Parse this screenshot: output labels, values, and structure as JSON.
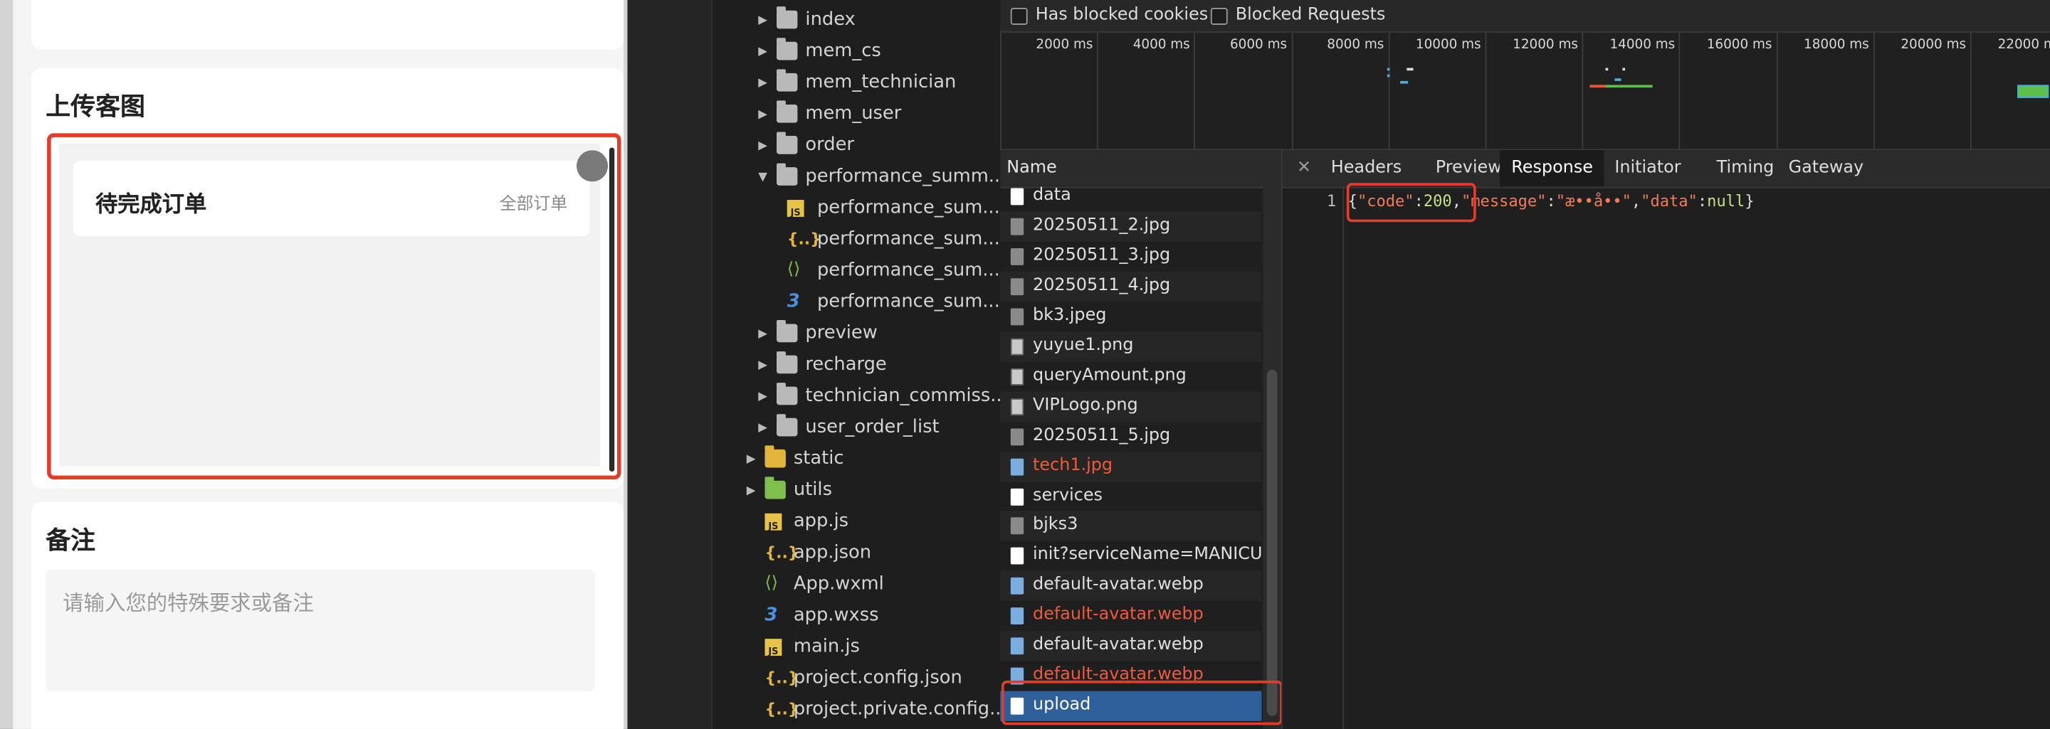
{
  "phone": {
    "upload_title": "上传客图",
    "pending_orders_title": "待完成订单",
    "all_orders_link": "全部订单",
    "remark_title": "备注",
    "remark_placeholder": "请输入您的特殊要求或备注"
  },
  "file_tree": {
    "items": [
      {
        "label": "index",
        "type": "folder",
        "expanded": false
      },
      {
        "label": "mem_cs",
        "type": "folder",
        "expanded": false
      },
      {
        "label": "mem_technician",
        "type": "folder",
        "expanded": false
      },
      {
        "label": "mem_user",
        "type": "folder",
        "expanded": false
      },
      {
        "label": "order",
        "type": "folder",
        "expanded": false
      },
      {
        "label": "performance_summ...",
        "type": "folder",
        "expanded": true
      },
      {
        "label": "performance_sum...",
        "type": "js"
      },
      {
        "label": "performance_sum...",
        "type": "json"
      },
      {
        "label": "performance_sum...",
        "type": "wxml"
      },
      {
        "label": "performance_sum...",
        "type": "wxss"
      },
      {
        "label": "preview",
        "type": "folder",
        "expanded": false
      },
      {
        "label": "recharge",
        "type": "folder",
        "expanded": false
      },
      {
        "label": "technician_commiss...",
        "type": "folder",
        "expanded": false
      },
      {
        "label": "user_order_list",
        "type": "folder",
        "expanded": false
      },
      {
        "label": "static",
        "type": "folder-yellow",
        "expanded": false
      },
      {
        "label": "utils",
        "type": "folder-green",
        "expanded": false
      },
      {
        "label": "app.js",
        "type": "js"
      },
      {
        "label": "app.json",
        "type": "json"
      },
      {
        "label": "App.wxml",
        "type": "wxml"
      },
      {
        "label": "app.wxss",
        "type": "wxss"
      },
      {
        "label": "main.js",
        "type": "js"
      },
      {
        "label": "project.config.json",
        "type": "json"
      },
      {
        "label": "project.private.config...",
        "type": "json"
      }
    ]
  },
  "devtools": {
    "filters": {
      "blocked_cookies": "Has blocked cookies",
      "blocked_requests": "Blocked Requests"
    },
    "timeline_ticks": [
      "2000 ms",
      "4000 ms",
      "6000 ms",
      "8000 ms",
      "10000 ms",
      "12000 ms",
      "14000 ms",
      "16000 ms",
      "18000 ms",
      "20000 ms",
      "22000 ms"
    ],
    "name_header": "Name",
    "requests": [
      {
        "name": "data",
        "icon": "doc",
        "error": false
      },
      {
        "name": "20250511_2.jpg",
        "icon": "img",
        "error": false
      },
      {
        "name": "20250511_3.jpg",
        "icon": "img",
        "error": false
      },
      {
        "name": "20250511_4.jpg",
        "icon": "img",
        "error": false
      },
      {
        "name": "bk3.jpeg",
        "icon": "img",
        "error": false
      },
      {
        "name": "yuyue1.png",
        "icon": "pic",
        "error": false
      },
      {
        "name": "queryAmount.png",
        "icon": "pic",
        "error": false
      },
      {
        "name": "VIPLogo.png",
        "icon": "pic",
        "error": false
      },
      {
        "name": "20250511_5.jpg",
        "icon": "img",
        "error": false
      },
      {
        "name": "tech1.jpg",
        "icon": "blue",
        "error": true
      },
      {
        "name": "services",
        "icon": "doc",
        "error": false
      },
      {
        "name": "bjks3",
        "icon": "img",
        "error": false
      },
      {
        "name": "init?serviceName=MANICUR...",
        "icon": "doc",
        "error": false
      },
      {
        "name": "default-avatar.webp",
        "icon": "blue",
        "error": false
      },
      {
        "name": "default-avatar.webp",
        "icon": "blue",
        "error": true
      },
      {
        "name": "default-avatar.webp",
        "icon": "blue",
        "error": false
      },
      {
        "name": "default-avatar.webp",
        "icon": "blue",
        "error": true
      },
      {
        "name": "upload",
        "icon": "doc",
        "error": false,
        "selected": true
      }
    ],
    "tabs": [
      "Headers",
      "Preview",
      "Response",
      "Initiator",
      "Timing",
      "Gateway"
    ],
    "active_tab": "Response",
    "response": {
      "line_number": "1",
      "p1": "{",
      "key_code": "\"code\"",
      "colon1": ":",
      "val_code": "200",
      "comma1": ",",
      "key_message": "\"message\"",
      "colon2": ":",
      "val_message": "\"æ••å••\"",
      "comma2": ",",
      "key_data": "\"data\"",
      "colon3": ":",
      "val_data": "null",
      "p2": "}"
    }
  }
}
